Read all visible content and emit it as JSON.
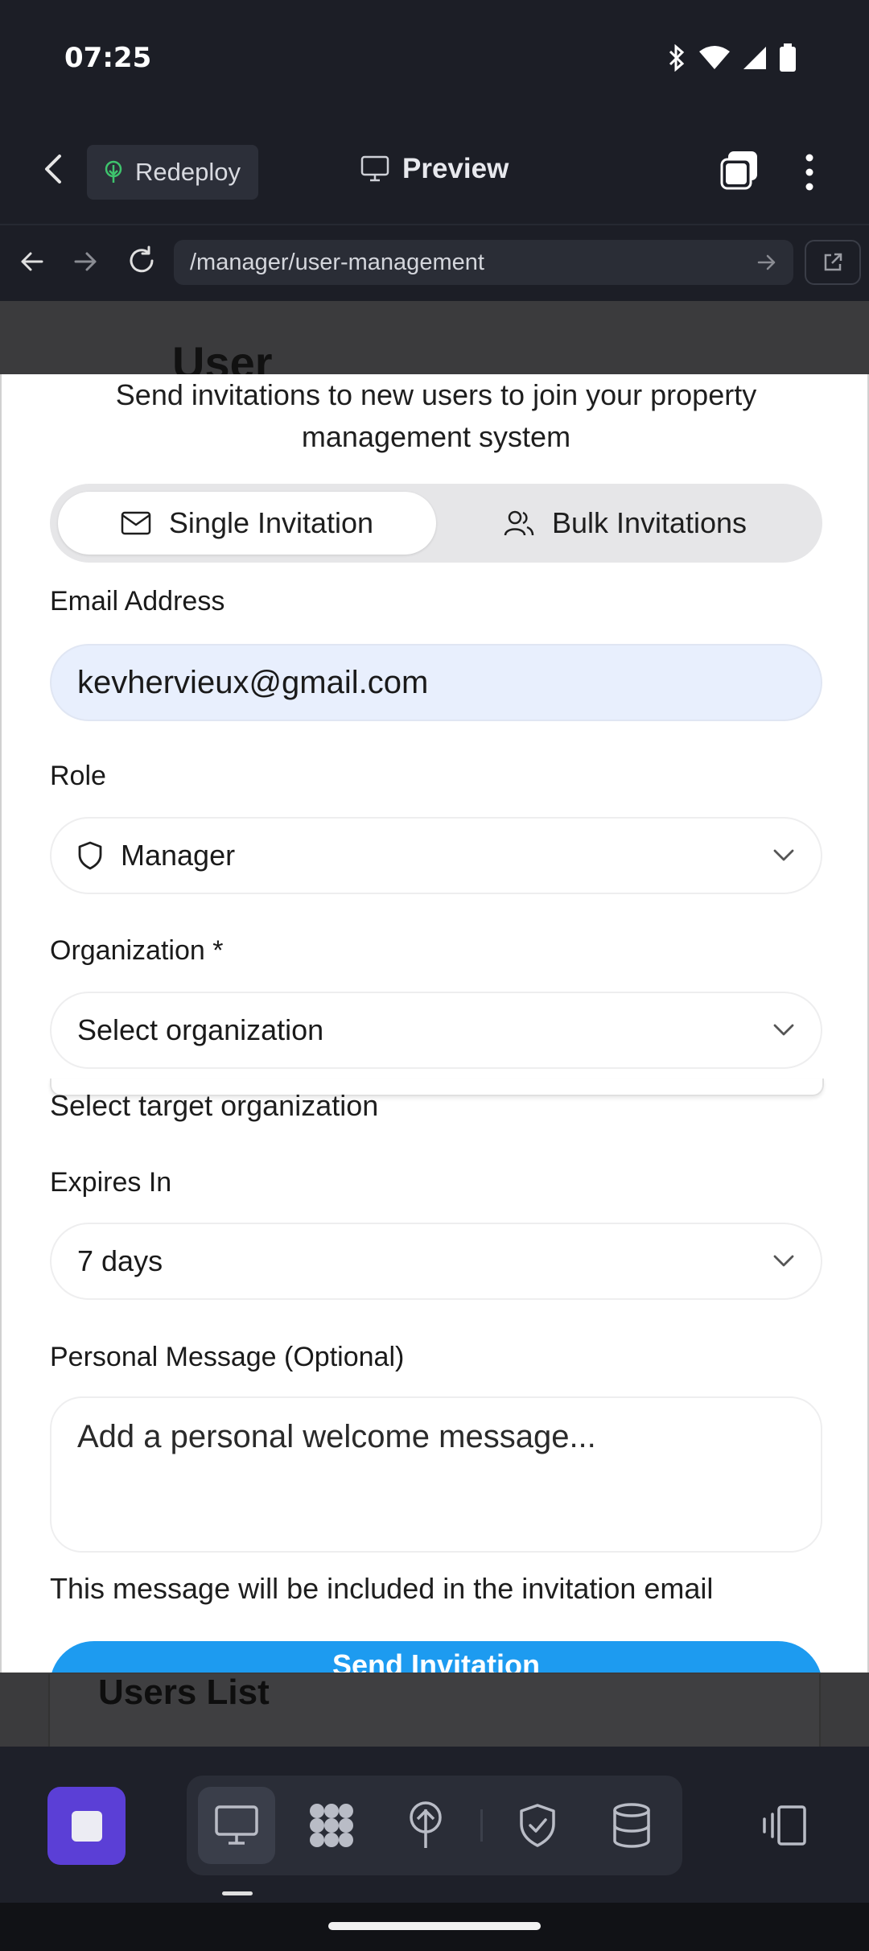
{
  "status_bar": {
    "time": "07:25"
  },
  "header": {
    "redeploy_label": "Redeploy",
    "preview_label": "Preview"
  },
  "url_bar": {
    "path": "/manager/user-management"
  },
  "background_page": {
    "title": "User",
    "section_title": "Users List"
  },
  "modal": {
    "description": "Send invitations to new users to join your property management system",
    "tabs": [
      {
        "label": "Single Invitation",
        "icon": "mail-icon",
        "active": true
      },
      {
        "label": "Bulk Invitations",
        "icon": "users-icon",
        "active": false
      }
    ],
    "email": {
      "label": "Email Address",
      "value": "kevhervieux@gmail.com"
    },
    "role": {
      "label": "Role",
      "value": "Manager",
      "icon": "shield-icon"
    },
    "organization": {
      "label": "Organization *",
      "placeholder": "Select organization",
      "hint": "Select target organization"
    },
    "expires": {
      "label": "Expires In",
      "value": "7 days"
    },
    "message": {
      "label": "Personal Message (Optional)",
      "placeholder": "Add a personal welcome message...",
      "hint": "This message will be included in the invitation email"
    },
    "submit_label": "Send Invitation"
  },
  "toolbar": {
    "items": [
      "stop-icon",
      "monitor-icon",
      "apps-icon",
      "deploy-icon",
      "security-icon",
      "database-icon",
      "devices-icon"
    ],
    "accent": "#5b3fd6"
  },
  "colors": {
    "primary_button": "#1d9bf0",
    "email_field_bg": "#e8effd",
    "chrome_bg": "#1c1e26"
  }
}
